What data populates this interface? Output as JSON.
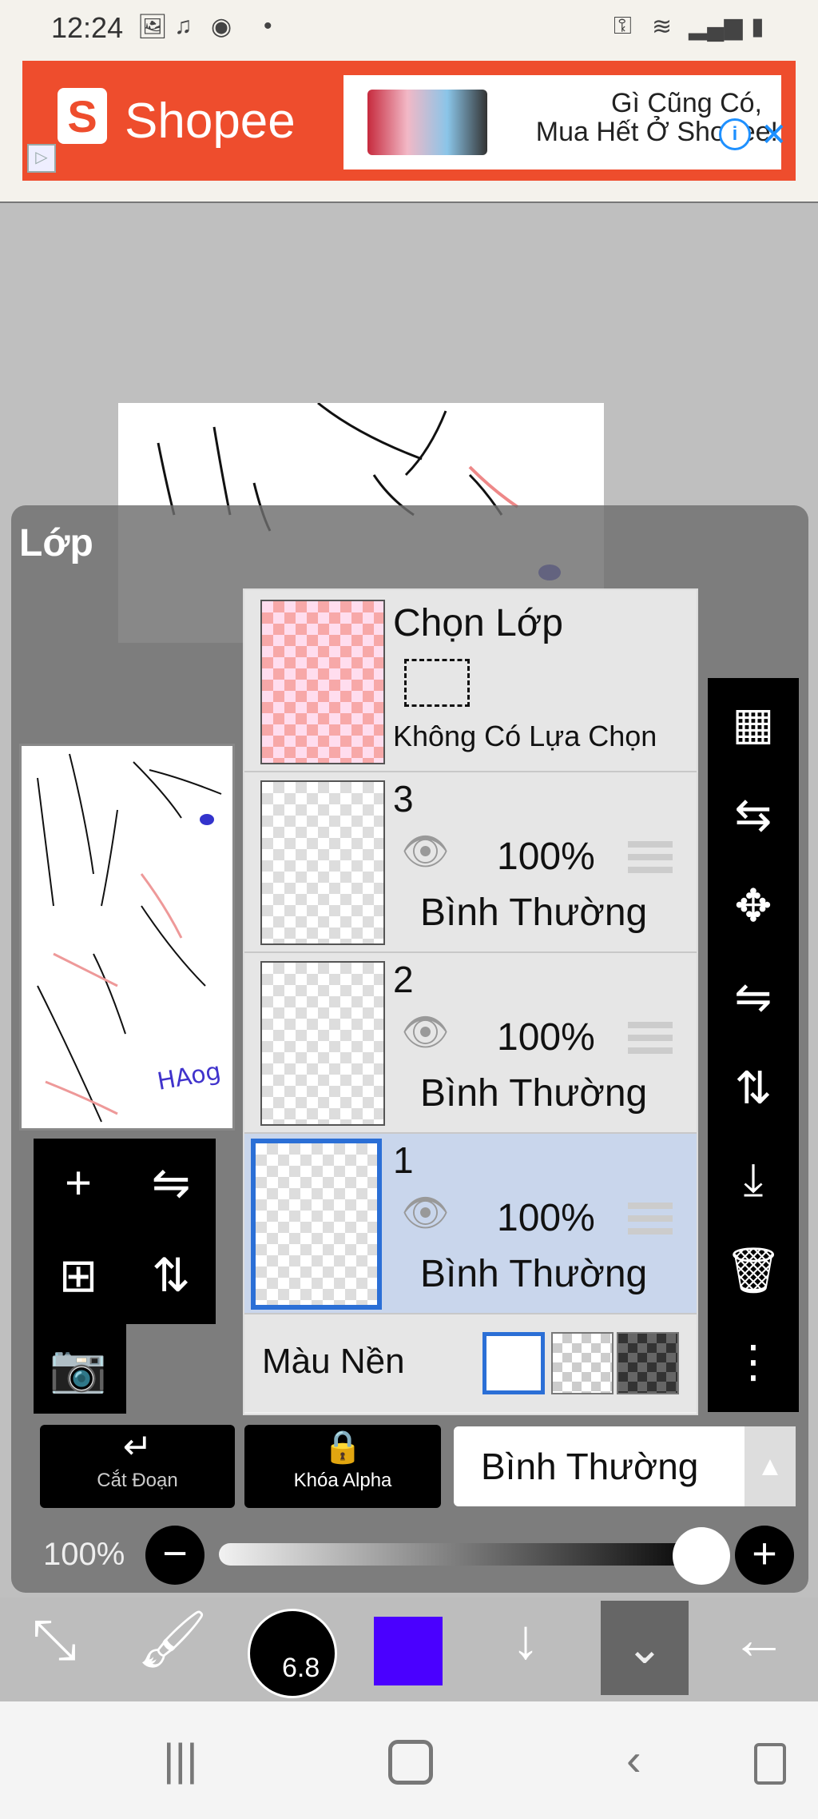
{
  "status_bar": {
    "time": "12:24",
    "icons": [
      "image-icon",
      "tiktok-icon",
      "messenger-icon",
      "dot",
      "key-icon",
      "wifi-icon",
      "signal-icon",
      "signal-icon",
      "battery-icon"
    ]
  },
  "ad": {
    "brand": "Shopee",
    "line1": "Gì Cũng Có,",
    "line2": "Mua Hết Ở Shopee!",
    "accent": "#ee4d2d"
  },
  "panel": {
    "title": "Lớp",
    "selection_layer": {
      "title": "Chọn Lớp",
      "status": "Không Có Lựa Chọn"
    },
    "layers": [
      {
        "name": "3",
        "opacity": "100%",
        "mode": "Bình Thường",
        "selected": false
      },
      {
        "name": "2",
        "opacity": "100%",
        "mode": "Bình Thường",
        "selected": false
      },
      {
        "name": "1",
        "opacity": "100%",
        "mode": "Bình Thường",
        "selected": true
      }
    ],
    "background_label": "Màu Nền",
    "clip_label": "Cắt Đoạn",
    "alpha_lock_label": "Khóa Alpha",
    "blend_mode": "Bình Thường",
    "opacity_label": "100%",
    "opacity_value": 100
  },
  "toolbar": {
    "brush_size": "6.8",
    "color": "#4a00ff"
  },
  "preview": {
    "signature": "HAog"
  }
}
